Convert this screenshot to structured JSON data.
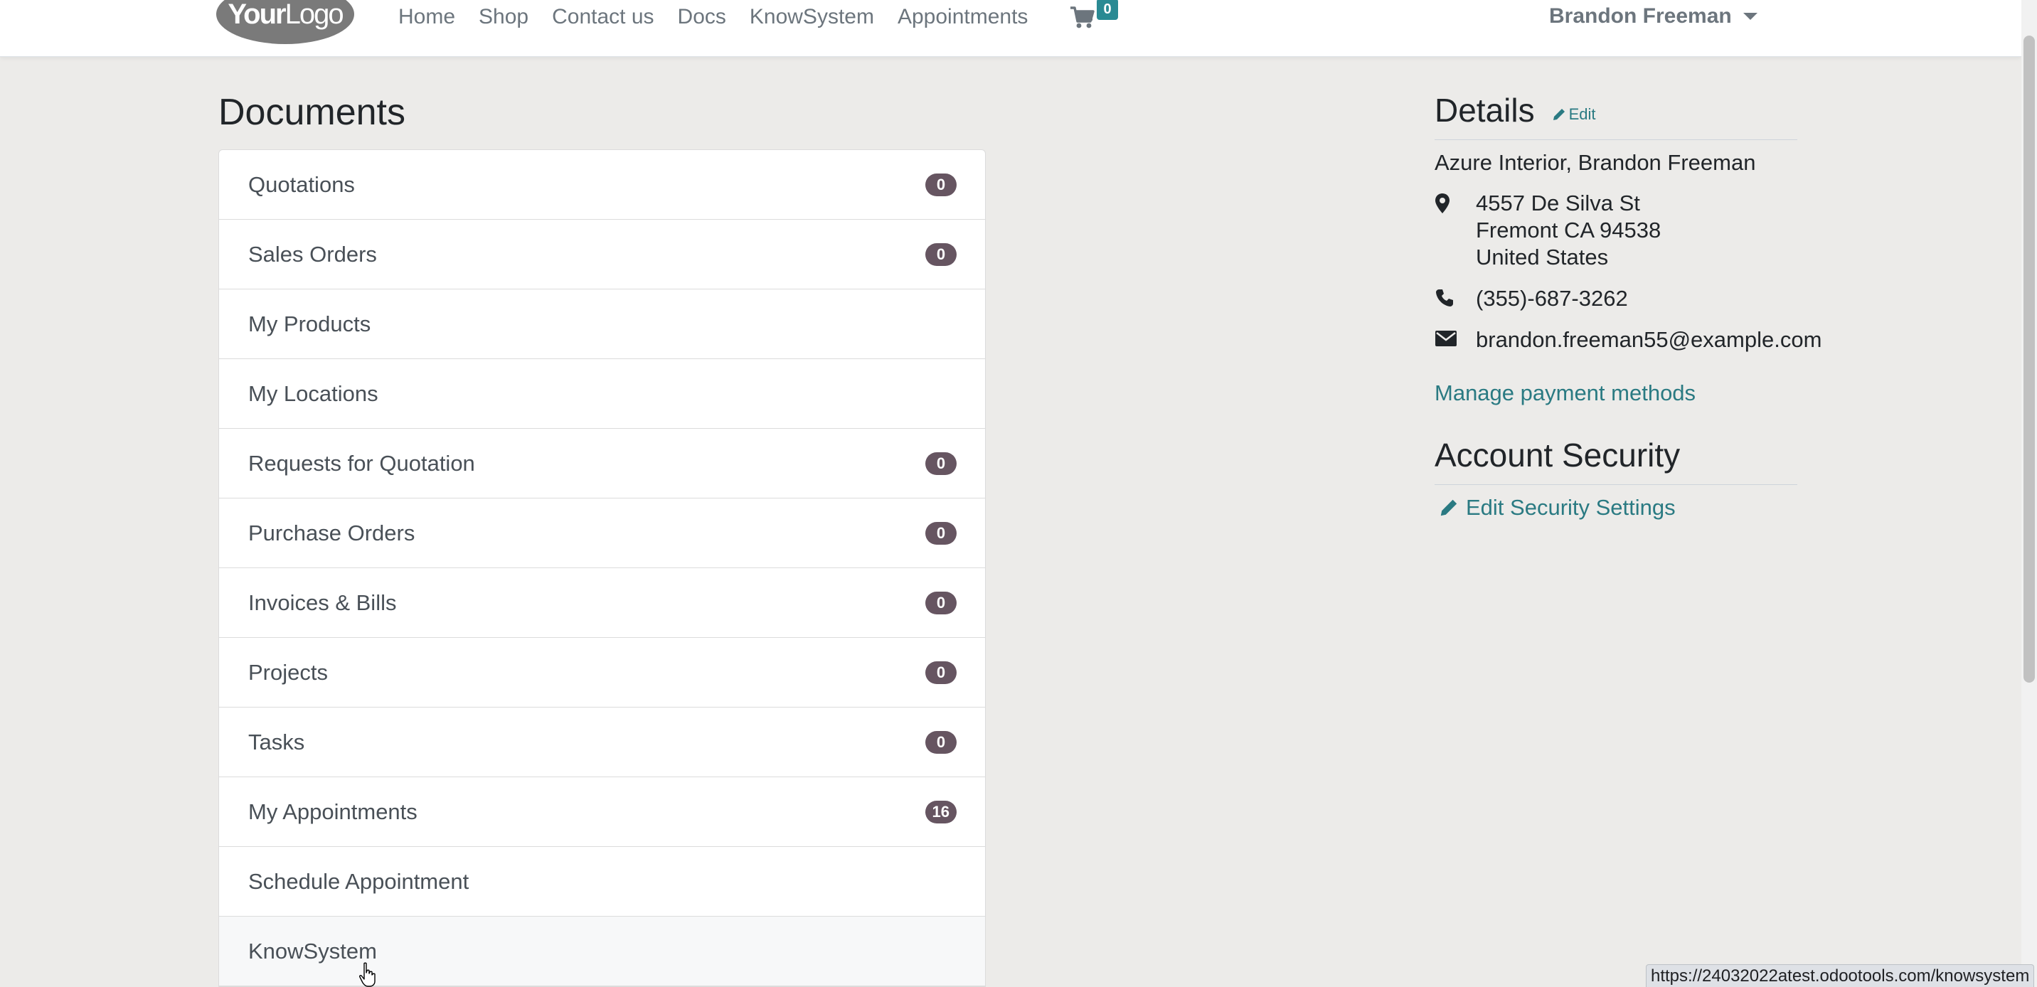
{
  "header": {
    "logo": {
      "part1": "Your",
      "part2": "Logo"
    },
    "nav": [
      "Home",
      "Shop",
      "Contact us",
      "Docs",
      "KnowSystem",
      "Appointments"
    ],
    "cart_count": "0",
    "user_name": "Brandon Freeman"
  },
  "documents": {
    "title": "Documents",
    "items": [
      {
        "label": "Quotations",
        "badge": "0"
      },
      {
        "label": "Sales Orders",
        "badge": "0"
      },
      {
        "label": "My Products",
        "badge": null
      },
      {
        "label": "My Locations",
        "badge": null
      },
      {
        "label": "Requests for Quotation",
        "badge": "0"
      },
      {
        "label": "Purchase Orders",
        "badge": "0"
      },
      {
        "label": "Invoices & Bills",
        "badge": "0"
      },
      {
        "label": "Projects",
        "badge": "0"
      },
      {
        "label": "Tasks",
        "badge": "0"
      },
      {
        "label": "My Appointments",
        "badge": "16"
      },
      {
        "label": "Schedule Appointment",
        "badge": null
      },
      {
        "label": "KnowSystem",
        "badge": null
      }
    ]
  },
  "details": {
    "title": "Details",
    "edit_label": "Edit",
    "company": "Azure Interior, Brandon Freeman",
    "address": [
      "4557 De Silva St",
      "Fremont CA 94538",
      "United States"
    ],
    "phone": "(355)-687-3262",
    "email": "brandon.freeman55@example.com",
    "payment_link": "Manage payment methods"
  },
  "security": {
    "title": "Account Security",
    "edit_settings": "Edit Security Settings"
  },
  "status_url": "https://24032022atest.odootools.com/knowsystem",
  "colors": {
    "background": "#ecebe9",
    "accent": "#2a7a82",
    "badge": "#665561",
    "cart_badge": "#2a8a93"
  }
}
